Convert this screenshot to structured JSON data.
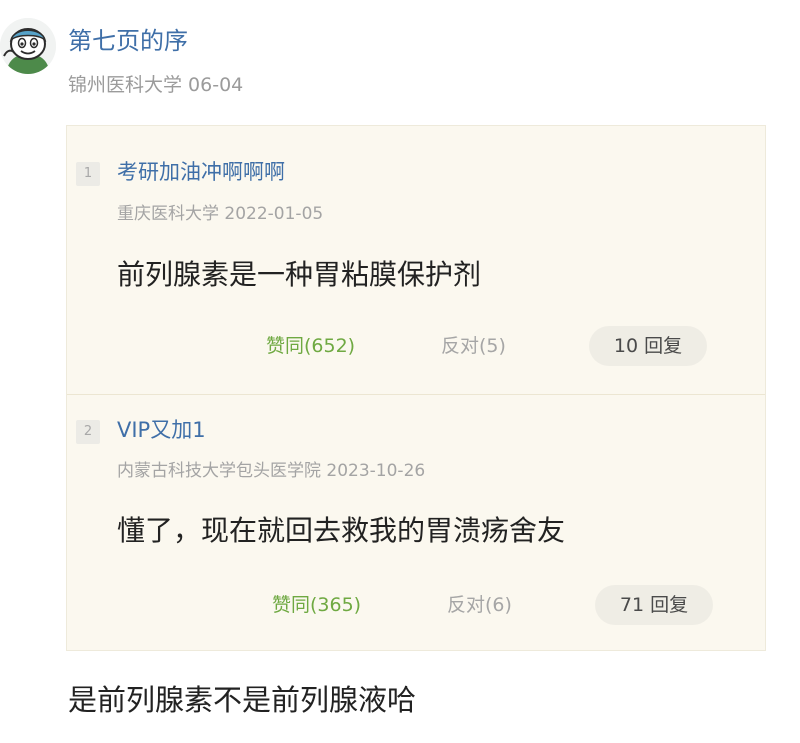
{
  "post": {
    "author": "第七页的序",
    "school_date": "锦州医科大学 06-04",
    "text": "是前列腺素不是前列腺液哈"
  },
  "quotes": [
    {
      "index": "1",
      "user": "考研加油冲啊啊啊",
      "meta": "重庆医科大学 2022-01-05",
      "content": "前列腺素是一种胃粘膜保护剂",
      "agree": "赞同(652)",
      "against": "反对(5)",
      "replies": "10 回复"
    },
    {
      "index": "2",
      "user": "VIP又加1",
      "meta": "内蒙古科技大学包头医学院 2023-10-26",
      "content": "懂了，现在就回去救我的胃溃疡舍友",
      "agree": "赞同(365)",
      "against": "反对(6)",
      "replies": "71 回复"
    }
  ],
  "colors": {
    "link_blue": "#3f6fa8",
    "agree_green": "#6fa942",
    "quote_bg": "#fbf8ef"
  },
  "icons": {
    "avatar": "cartoon-character-avatar"
  }
}
